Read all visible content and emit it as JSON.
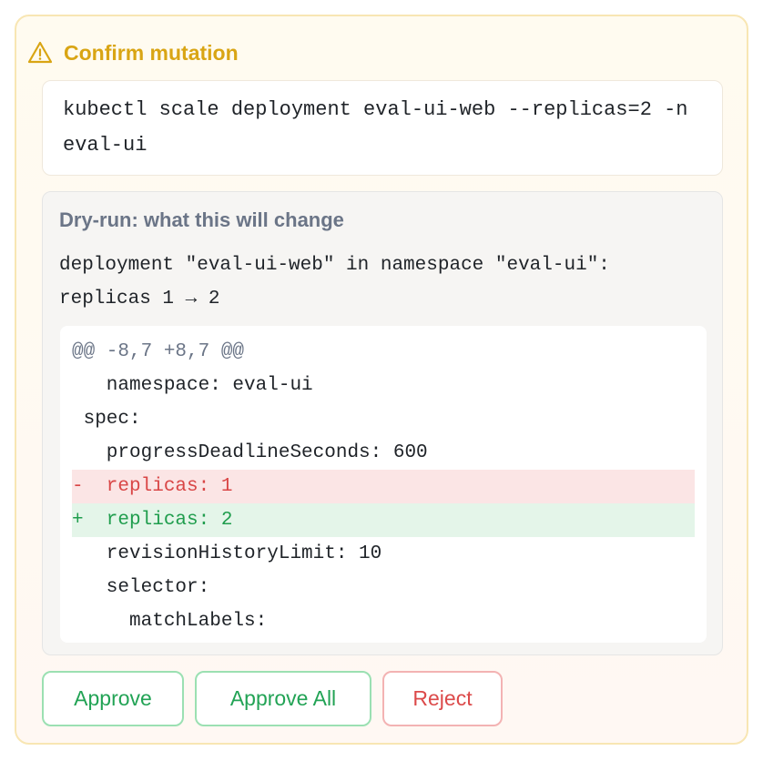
{
  "header": {
    "icon": "warning-icon",
    "title": "Confirm mutation",
    "accent_color": "#d9a514"
  },
  "command": {
    "text": "kubectl scale deployment eval-ui-web --replicas=2 -n eval-ui"
  },
  "dry_run": {
    "title": "Dry-run: what this will change",
    "summary": "deployment \"eval-ui-web\" in namespace \"eval-ui\":\nreplicas 1 → 2",
    "diff": [
      {
        "type": "hunk",
        "text": "@@ -8,7 +8,7 @@"
      },
      {
        "type": "ctx",
        "text": "   namespace: eval-ui"
      },
      {
        "type": "ctx",
        "text": " spec:"
      },
      {
        "type": "ctx",
        "text": "   progressDeadlineSeconds: 600"
      },
      {
        "type": "del",
        "text": "-  replicas: 1"
      },
      {
        "type": "add",
        "text": "+  replicas: 2"
      },
      {
        "type": "ctx",
        "text": "   revisionHistoryLimit: 10"
      },
      {
        "type": "ctx",
        "text": "   selector:"
      },
      {
        "type": "ctx",
        "text": "     matchLabels:"
      }
    ]
  },
  "actions": {
    "approve_label": "Approve",
    "approve_all_label": "Approve All",
    "reject_label": "Reject",
    "approve_color": "#22a355",
    "reject_color": "#dc4a4a"
  }
}
